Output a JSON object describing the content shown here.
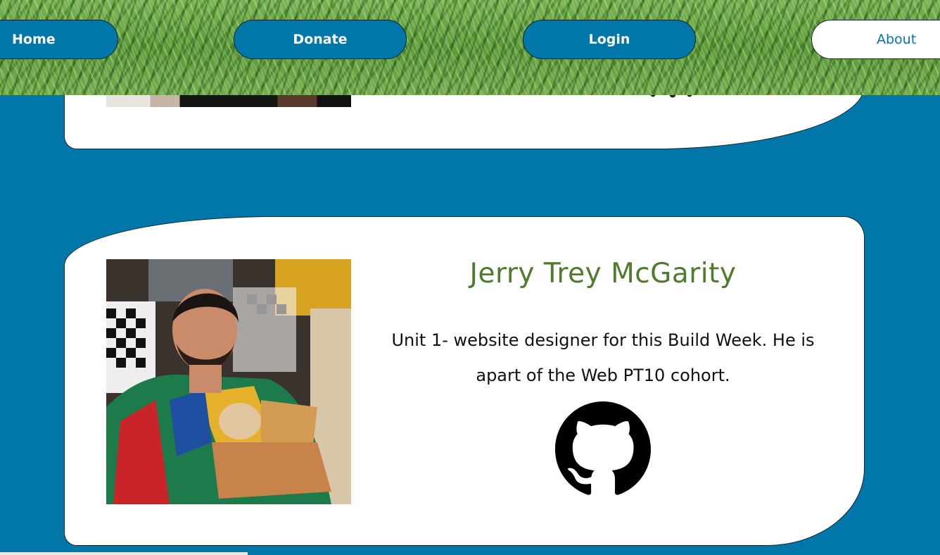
{
  "nav": {
    "home_label": "Home",
    "donate_label": "Donate",
    "login_label": "Login",
    "about_label": "About"
  },
  "member": {
    "name": "Jerry Trey McGarity",
    "bio": "Unit 1- website designer for this Build Week. He is apart of the Web PT10 cohort.",
    "photo_icon": "member-photo",
    "github_icon": "github-icon"
  },
  "colors": {
    "page_background": "#0077a8",
    "nav_button": "#0077a8",
    "active_nav_button": "#ffffff",
    "name_text": "#4e7b2c",
    "card_background": "#ffffff"
  }
}
